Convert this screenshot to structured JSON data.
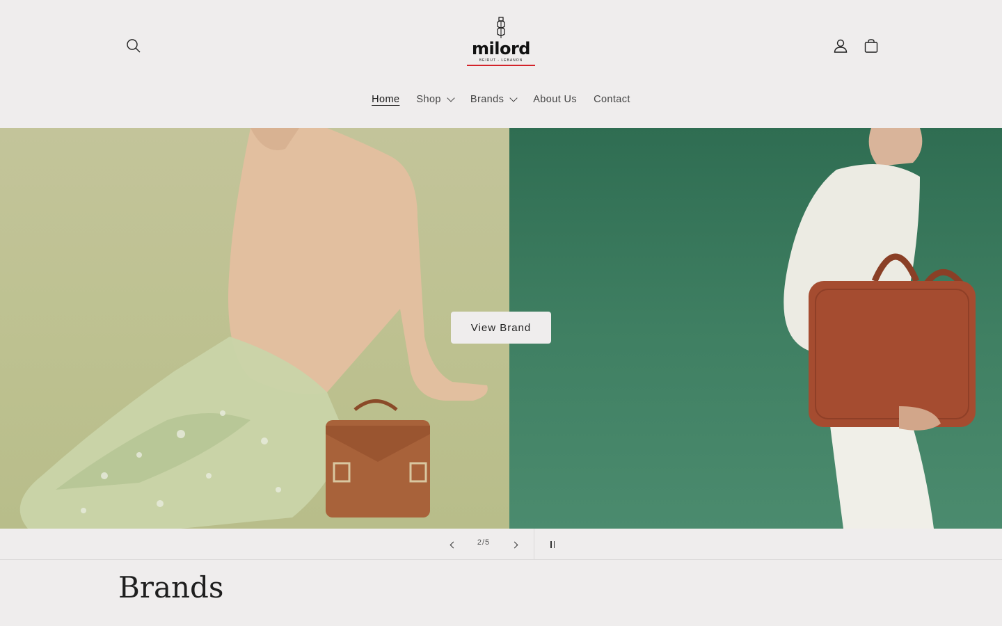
{
  "header": {
    "logo_text": "milord",
    "logo_subtitle": "BEIRUT - LEBANON",
    "icons": [
      "search-icon",
      "account-icon",
      "cart-icon"
    ]
  },
  "nav": {
    "items": [
      {
        "label": "Home",
        "active": true,
        "has_dropdown": false
      },
      {
        "label": "Shop",
        "active": false,
        "has_dropdown": true
      },
      {
        "label": "Brands",
        "active": false,
        "has_dropdown": true
      },
      {
        "label": "About Us",
        "active": false,
        "has_dropdown": false
      },
      {
        "label": "Contact",
        "active": false,
        "has_dropdown": false
      }
    ]
  },
  "hero": {
    "cta_label": "View Brand",
    "left_bg": "#bec291",
    "right_bg": "#3c7c5f"
  },
  "slider": {
    "counter": "2/5",
    "prev_icon": "chevron-left-icon",
    "next_icon": "chevron-right-icon",
    "pause_icon": "pause-icon"
  },
  "section": {
    "title": "Brands"
  }
}
